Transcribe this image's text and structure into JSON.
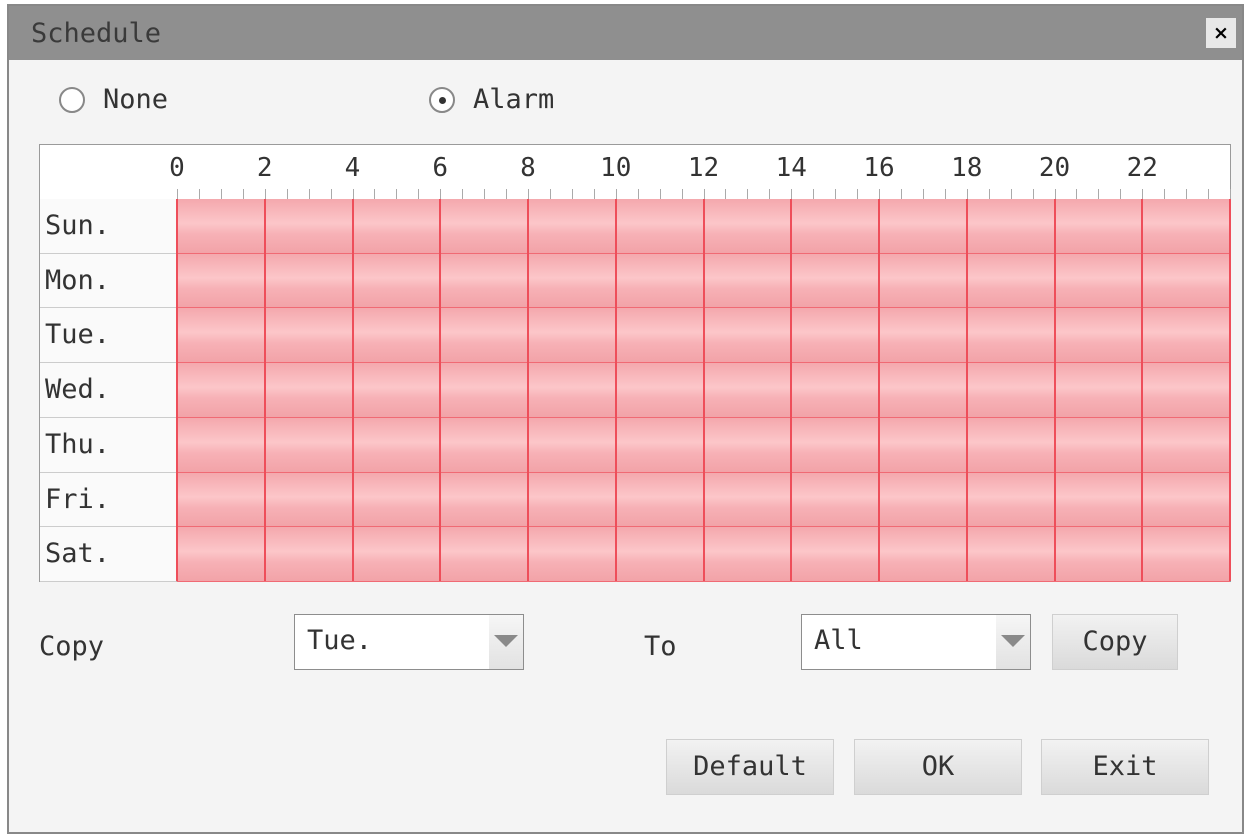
{
  "dialog": {
    "title": "Schedule",
    "close_label": "×"
  },
  "mode": {
    "options": [
      {
        "label": "None",
        "checked": false
      },
      {
        "label": "Alarm",
        "checked": true
      }
    ]
  },
  "schedule": {
    "hour_labels": [
      "0",
      "2",
      "4",
      "6",
      "8",
      "10",
      "12",
      "14",
      "16",
      "18",
      "20",
      "22"
    ],
    "days": [
      {
        "label": "Sun.",
        "coverage": "0-24"
      },
      {
        "label": "Mon.",
        "coverage": "0-24"
      },
      {
        "label": "Tue.",
        "coverage": "0-24"
      },
      {
        "label": "Wed.",
        "coverage": "0-24"
      },
      {
        "label": "Thu.",
        "coverage": "0-24"
      },
      {
        "label": "Fri.",
        "coverage": "0-24"
      },
      {
        "label": "Sat.",
        "coverage": "0-24"
      }
    ],
    "fill_color": "#f7b1b6",
    "line_color": "#ee4e5a"
  },
  "copy": {
    "label": "Copy",
    "from_value": "Tue.",
    "to_label": "To",
    "to_value": "All",
    "button_label": "Copy"
  },
  "footer": {
    "default_label": "Default",
    "ok_label": "OK",
    "exit_label": "Exit"
  }
}
